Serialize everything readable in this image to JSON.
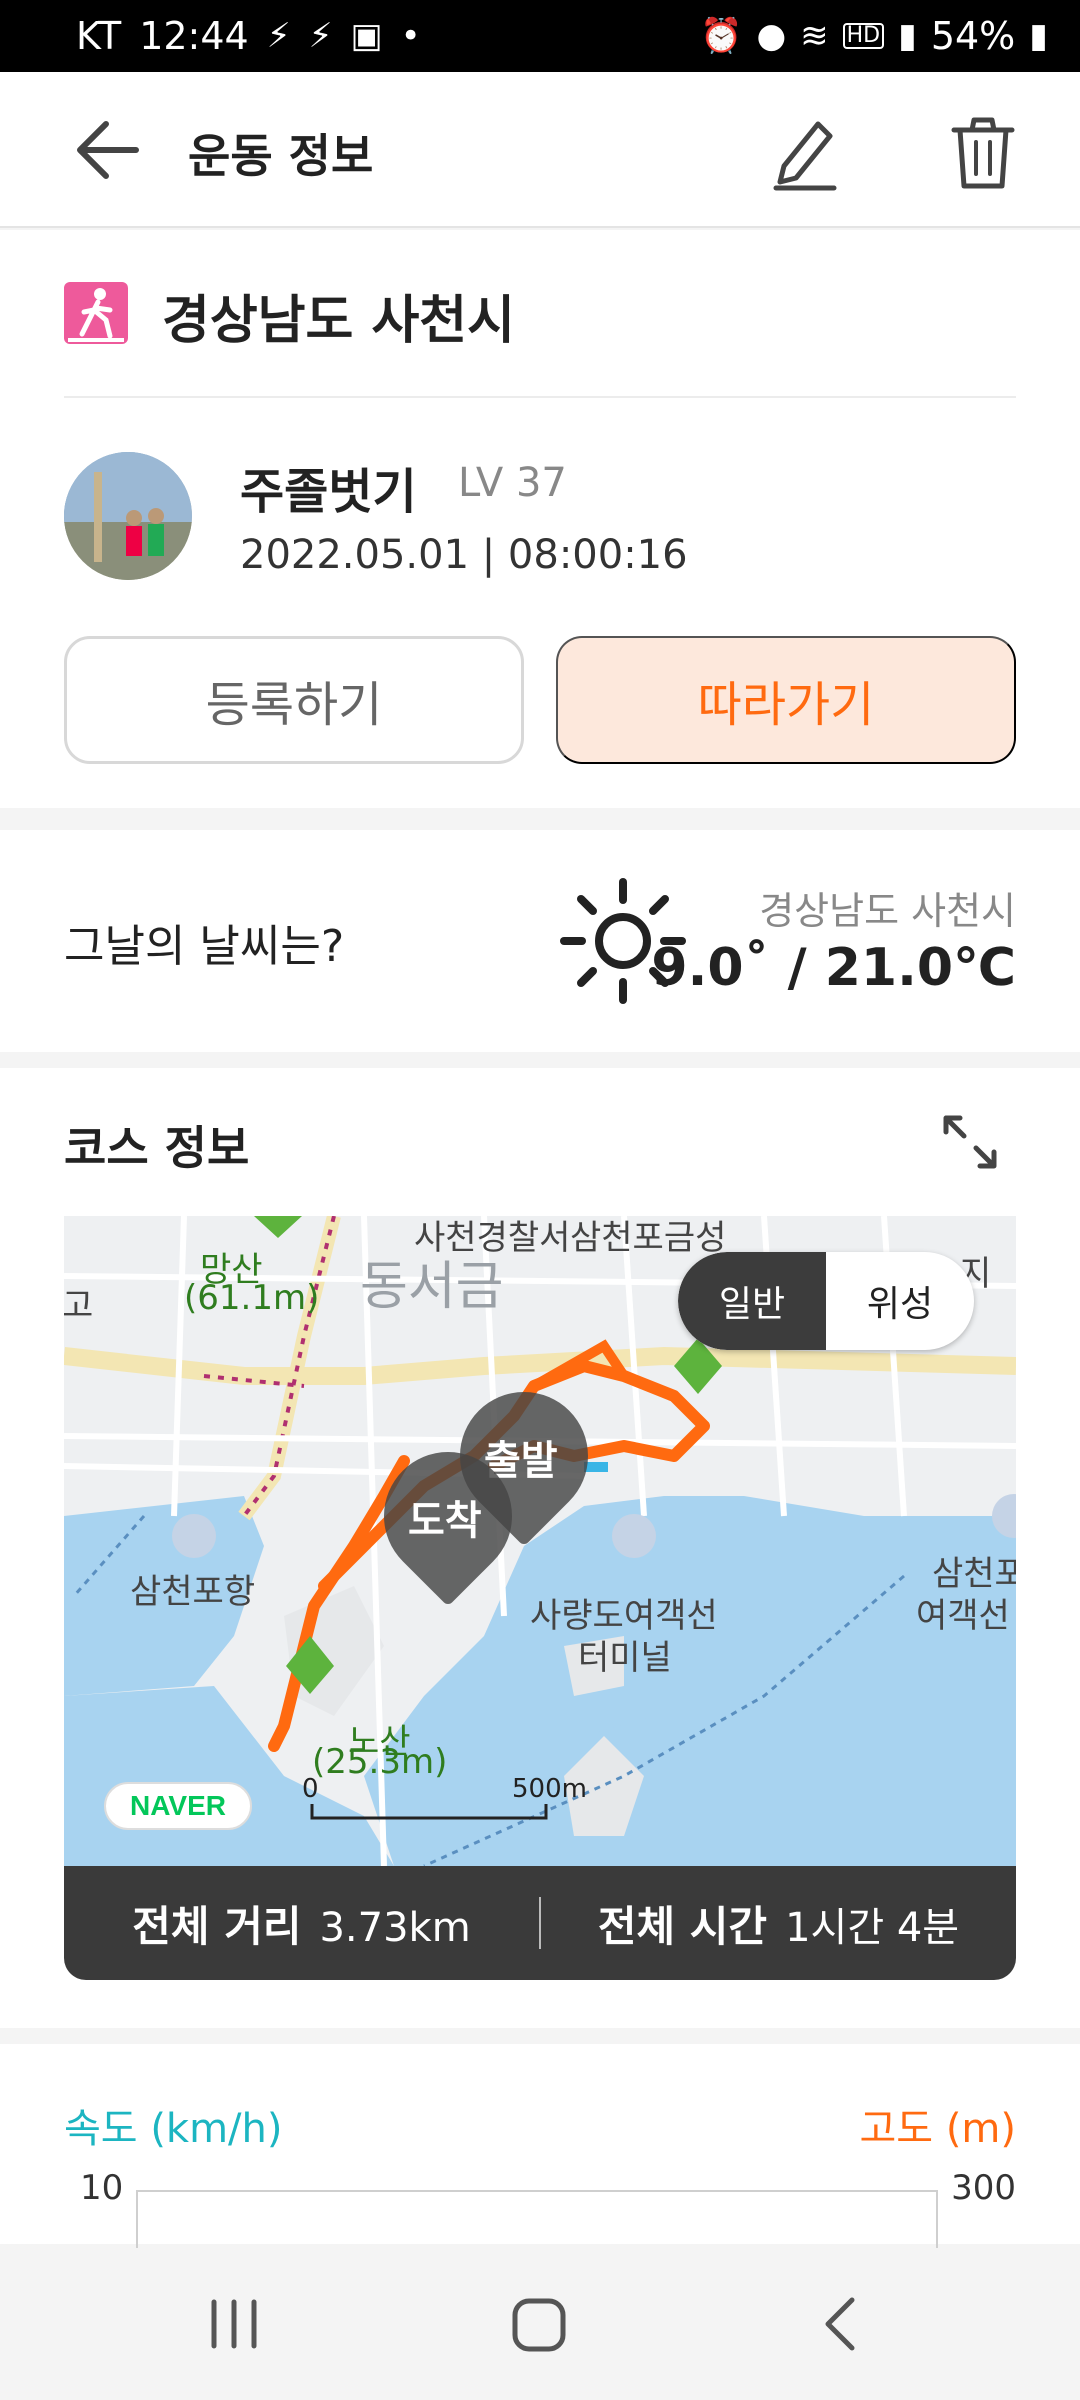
{
  "status_bar": {
    "carrier": "KT",
    "time": "12:44",
    "battery": "54%"
  },
  "header": {
    "title": "운동 정보"
  },
  "activity": {
    "location": "경상남도 사천시",
    "icon": "walking-person-icon"
  },
  "user": {
    "name": "주졸벗기",
    "level": "LV 37",
    "datetime": "2022.05.01 | 08:00:16"
  },
  "actions": {
    "register": "등록하기",
    "follow": "따라가기"
  },
  "weather": {
    "question": "그날의 날씨는?",
    "location": "경상남도 사천시",
    "temperature": "9.0˚ / 21.0℃",
    "icon": "sun-icon"
  },
  "course": {
    "title": "코스 정보",
    "map": {
      "toggle": {
        "normal": "일반",
        "satellite": "위성",
        "selected": "normal"
      },
      "labels": {
        "mangsan": "망산",
        "mangsan_height": "(61.1m)",
        "police": "사천경찰서",
        "samcheonpo_geum": "삼천포금성",
        "ji": "지",
        "dongseogeum": "동서금",
        "go": "고",
        "samcheonpo_port": "삼천포항",
        "ferry_terminal_1": "사량도여객선",
        "ferry_terminal_2": "터미널",
        "samcheonpo_right_1": "삼천포",
        "samcheonpo_right_2": "여객선",
        "nosan": "노산",
        "nosan_height": "(25.3m)",
        "start": "출발",
        "arrive": "도착",
        "scale_start": "0",
        "scale_end": "500m",
        "provider": "NAVER"
      }
    },
    "summary": {
      "distance_label": "전체 거리",
      "distance_value": "3.73km",
      "time_label": "전체 시간",
      "time_value": "1시간 4분"
    }
  },
  "chart": {
    "speed_label": "속도 (km/h)",
    "altitude_label": "고도 (m)",
    "speed_max": "10",
    "altitude_max": "300"
  },
  "colors": {
    "accent": "#ff6a10",
    "speed": "#1cb5c1",
    "activity_icon": "#ee5a9b"
  }
}
